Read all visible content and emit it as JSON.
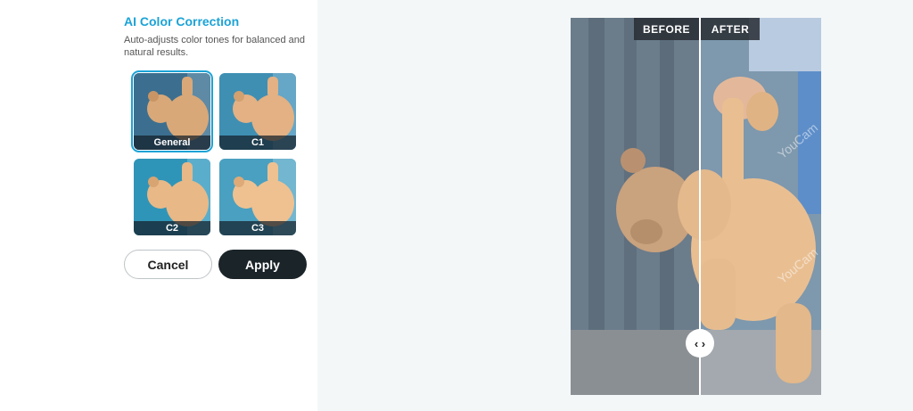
{
  "panel": {
    "title": "AI Color Correction",
    "description": "Auto-adjusts color tones for balanced and natural results."
  },
  "presets": [
    {
      "label": "General",
      "selected": true,
      "tint": "#3c6f8f"
    },
    {
      "label": "C1",
      "selected": false,
      "tint": "#3f8fb3"
    },
    {
      "label": "C2",
      "selected": false,
      "tint": "#2f95b8"
    },
    {
      "label": "C3",
      "selected": false,
      "tint": "#4aa0c0"
    }
  ],
  "buttons": {
    "cancel": "Cancel",
    "apply": "Apply"
  },
  "compare": {
    "before_label": "BEFORE",
    "after_label": "AFTER",
    "handle_icon": "chevron-left-right-icon",
    "watermark": "YouCam"
  },
  "colors": {
    "accent": "#1ba3d6",
    "apply_bg": "#1b2429"
  }
}
